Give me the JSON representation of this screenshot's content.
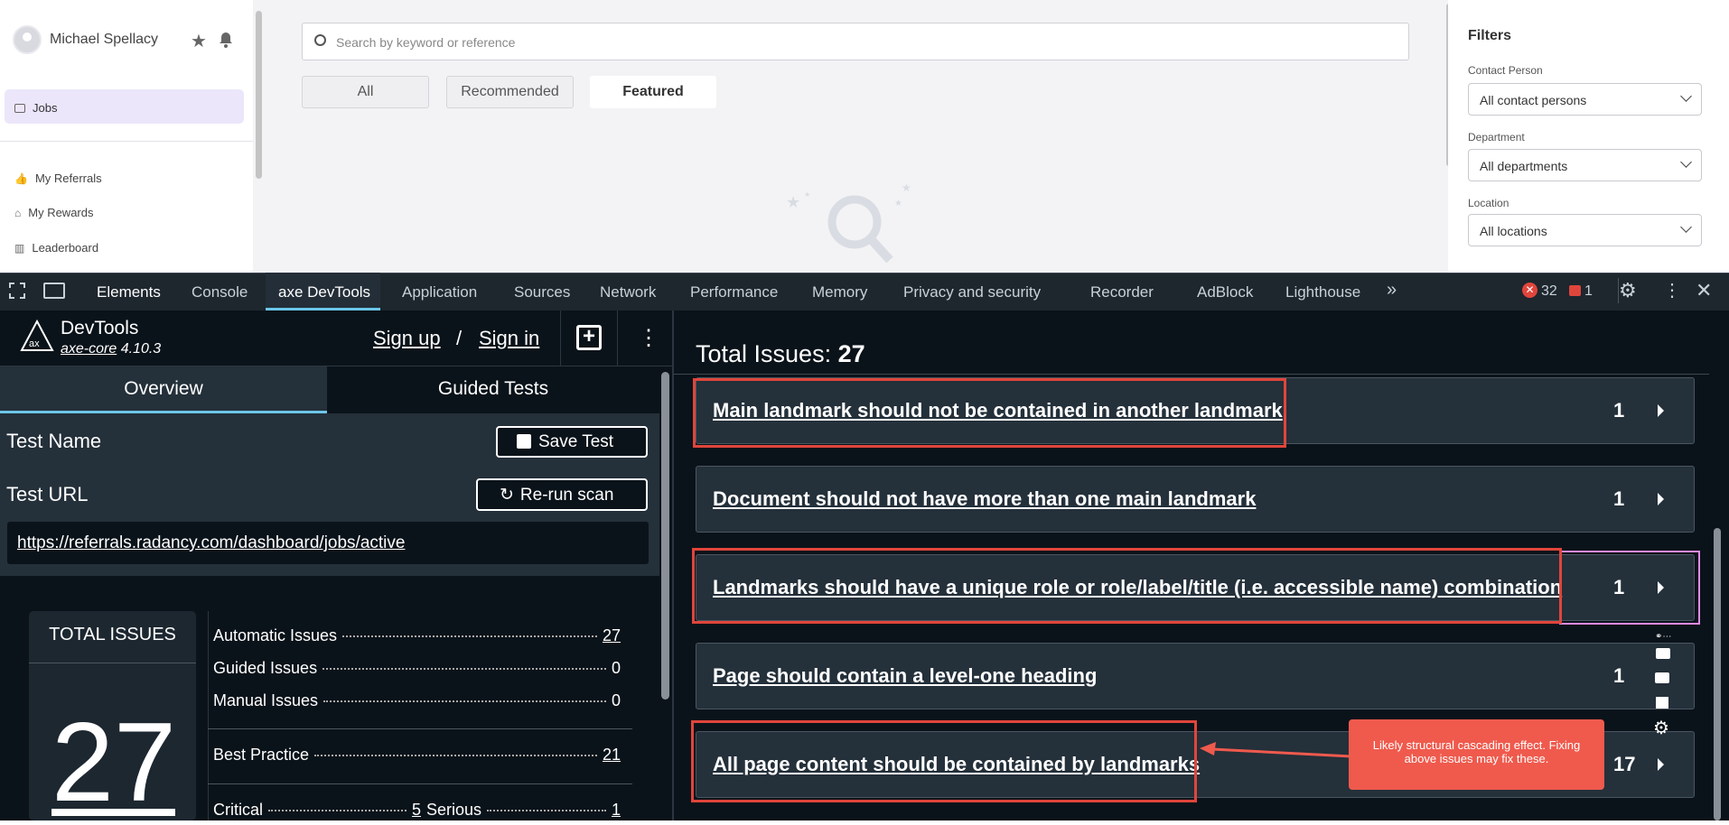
{
  "user": {
    "name": "Michael Spellacy"
  },
  "nav": {
    "jobs": "Jobs",
    "referrals": "My Referrals",
    "rewards": "My Rewards",
    "leaderboard": "Leaderboard"
  },
  "search": {
    "placeholder": "Search by keyword or reference"
  },
  "job_tabs": [
    "All",
    "Recommended",
    "Featured"
  ],
  "filters": {
    "title": "Filters",
    "contact_label": "Contact Person",
    "contact_value": "All contact persons",
    "department_label": "Department",
    "department_value": "All departments",
    "location_label": "Location",
    "location_value": "All locations"
  },
  "devtools": {
    "tabs": [
      "Elements",
      "Console",
      "axe DevTools",
      "Application",
      "Sources",
      "Network",
      "Performance",
      "Memory",
      "Privacy and security",
      "Recorder",
      "AdBlock",
      "Lighthouse"
    ],
    "errors": "32",
    "issues": "1"
  },
  "axe": {
    "brand": "DevTools",
    "core_link": "axe-core",
    "version": "4.10.3",
    "signup": "Sign up",
    "slash": "/",
    "signin": "Sign in",
    "overview": "Overview",
    "guided": "Guided Tests",
    "test_name": "Test Name",
    "save_test": "Save Test",
    "test_url": "Test URL",
    "rerun": "Re-run scan",
    "url": "https://referrals.radancy.com/dashboard/jobs/active",
    "total_label": "TOTAL ISSUES",
    "total_value": "27",
    "automatic_label": "Automatic Issues",
    "automatic": "27",
    "guided_label": "Guided Issues",
    "guided_issues": "0",
    "manual_label": "Manual Issues",
    "manual": "0",
    "best_label": "Best Practice",
    "best": "21",
    "critical_label": "Critical",
    "critical": "5",
    "serious_label": "Serious",
    "serious": "1"
  },
  "issues": {
    "title": "Total Issues:",
    "total": "27",
    "items": [
      {
        "text": "Main landmark should not be contained in another landmark",
        "count": "1"
      },
      {
        "text": "Document should not have more than one main landmark",
        "count": "1"
      },
      {
        "text": "Landmarks should have a unique role or role/label/title (i.e. accessible name) combination",
        "count": "1"
      },
      {
        "text": "Page should contain a level-one heading",
        "count": "1"
      },
      {
        "text": "All page content should be contained by landmarks",
        "count": "17"
      }
    ]
  },
  "callout": {
    "text": "Likely structural cascading effect. Fixing above issues may fix these.",
    "color": "#ef5a4d"
  }
}
